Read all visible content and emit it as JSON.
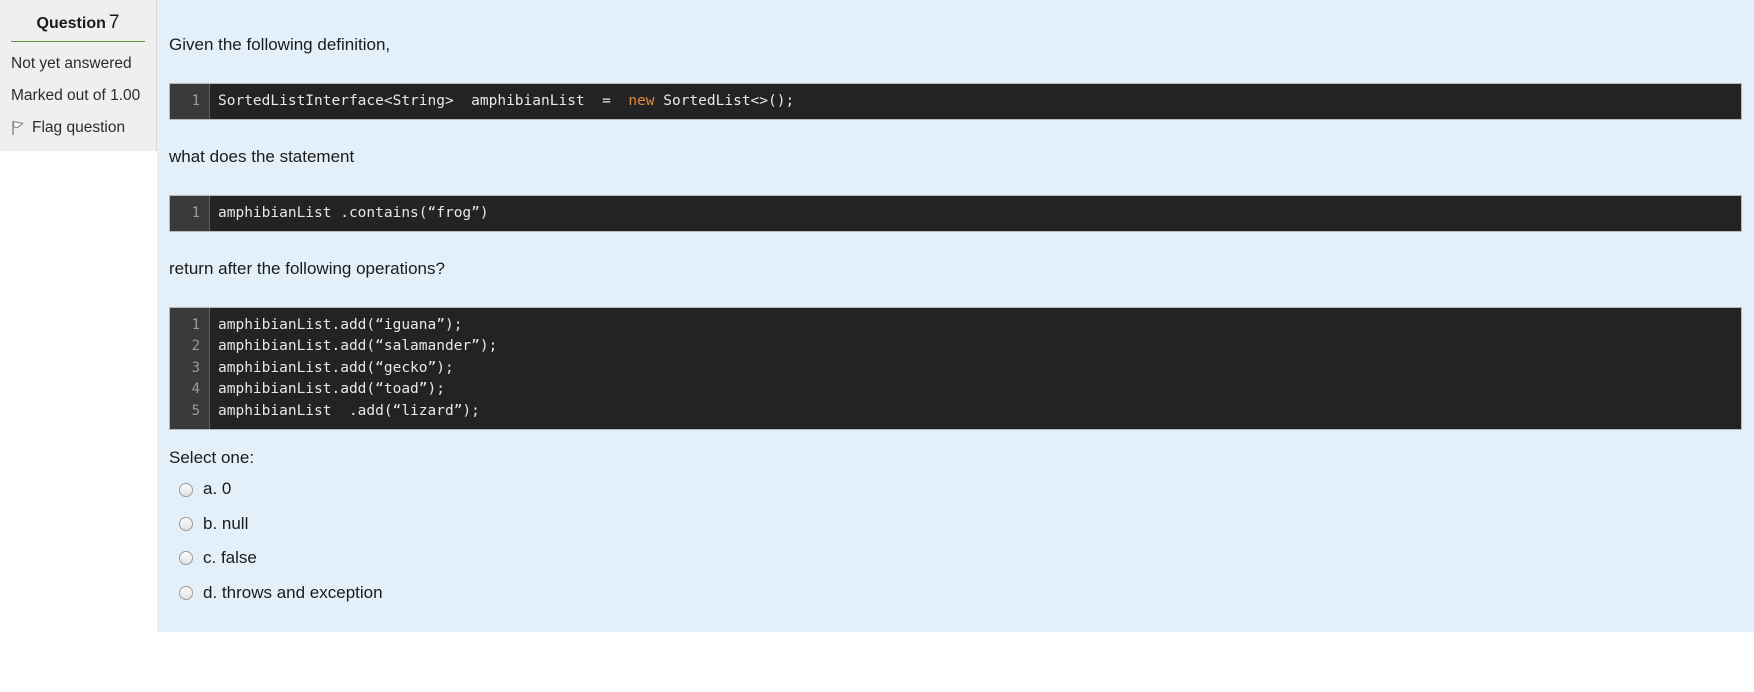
{
  "question_info": {
    "header_word": "Question",
    "header_number": "7",
    "status": "Not yet answered",
    "marks": "Marked out of 1.00",
    "flag_label": "Flag question",
    "flag_icon": "flag-icon",
    "accent_color": "#6b8e3e",
    "panel_bg": "#efefef"
  },
  "content": {
    "background": "#e3eff9",
    "intro_text": "Given the following definition,",
    "mid_text": "what does the statement",
    "post_text": "return after the following operations?",
    "definition_code": {
      "lines": [
        {
          "num": "1",
          "segments": [
            {
              "text": "SortedListInterface<String>  amphibianList  =  ",
              "kind": "plain"
            },
            {
              "text": "new",
              "kind": "keyword"
            },
            {
              "text": " SortedList<>();",
              "kind": "plain"
            }
          ]
        }
      ]
    },
    "statement_code": {
      "lines": [
        {
          "num": "1",
          "segments": [
            {
              "text": "amphibianList .contains(“frog”)",
              "kind": "plain"
            }
          ]
        }
      ]
    },
    "operations_code": {
      "lines": [
        {
          "num": "1",
          "segments": [
            {
              "text": "amphibianList.add(“iguana”);",
              "kind": "plain"
            }
          ]
        },
        {
          "num": "2",
          "segments": [
            {
              "text": "amphibianList.add(“salamander”);",
              "kind": "plain"
            }
          ]
        },
        {
          "num": "3",
          "segments": [
            {
              "text": "amphibianList.add(“gecko”);",
              "kind": "plain"
            }
          ]
        },
        {
          "num": "4",
          "segments": [
            {
              "text": "amphibianList.add(“toad”);",
              "kind": "plain"
            }
          ]
        },
        {
          "num": "5",
          "segments": [
            {
              "text": "amphibianList  .add(“lizard”);",
              "kind": "plain"
            }
          ]
        }
      ]
    },
    "select_one_label": "Select one:",
    "answers": [
      {
        "label": "a. 0",
        "selected": false
      },
      {
        "label": "b. null",
        "selected": false
      },
      {
        "label": "c. false",
        "selected": false
      },
      {
        "label": "d. throws and exception",
        "selected": false
      }
    ]
  }
}
